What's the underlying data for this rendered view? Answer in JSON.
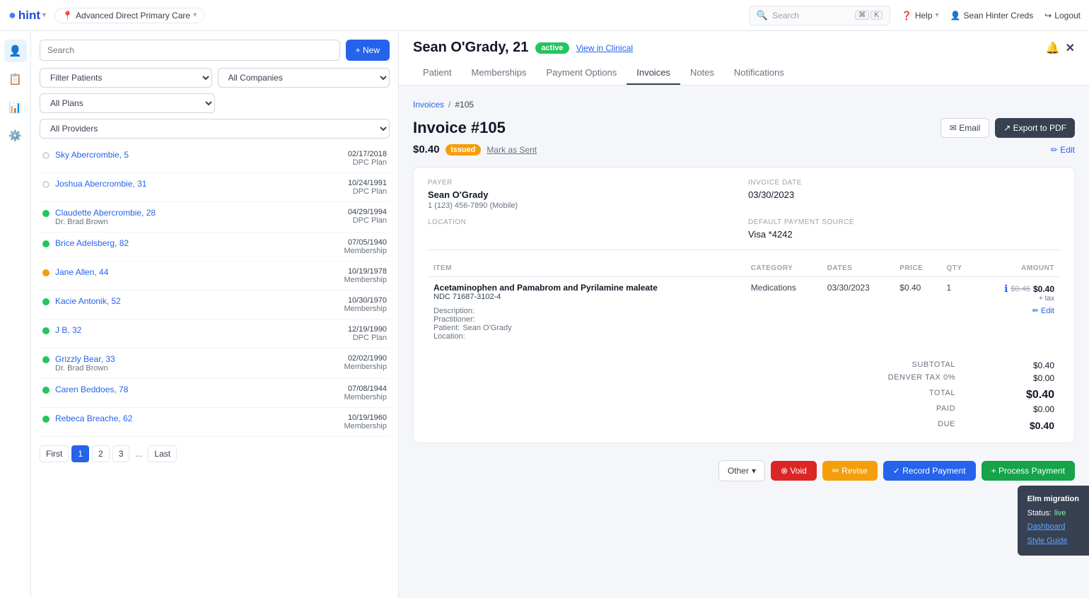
{
  "app": {
    "logo": "hint",
    "chevron": "▾",
    "location": "Advanced Direct Primary Care",
    "location_chevron": "▾"
  },
  "topbar": {
    "search_placeholder": "Search",
    "kbd1": "⌘",
    "kbd2": "K",
    "help": "Help",
    "user": "Sean Hinter Creds",
    "logout": "Logout"
  },
  "sidebar_icons": [
    "👤",
    "📋",
    "📊",
    "⚙️"
  ],
  "patient_panel": {
    "search_placeholder": "Search",
    "new_button": "+ New",
    "filter_patients": "Filter Patients",
    "all_companies": "All Companies",
    "all_plans": "All Plans",
    "all_providers": "All Providers",
    "patients": [
      {
        "name": "Sky Abercrombie, 5",
        "status": "inactive",
        "date": "02/17/2018",
        "plan": "DPC Plan"
      },
      {
        "name": "Joshua Abercrombie, 31",
        "status": "inactive",
        "date": "10/24/1991",
        "plan": "DPC Plan"
      },
      {
        "name": "Claudette Abercrombie, 28",
        "status": "active",
        "date": "04/29/1994",
        "plan": "DPC Plan",
        "sub": "Dr. Brad Brown"
      },
      {
        "name": "Brice Adelsberg, 82",
        "status": "active",
        "date": "07/05/1940",
        "plan": "Membership"
      },
      {
        "name": "Jane Allen, 44",
        "status": "pending",
        "date": "10/19/1978",
        "plan": "Membership"
      },
      {
        "name": "Kacie Antonik, 52",
        "status": "active",
        "date": "10/30/1970",
        "plan": "Membership"
      },
      {
        "name": "J B, 32",
        "status": "active",
        "date": "12/19/1990",
        "plan": "DPC Plan"
      },
      {
        "name": "Grizzly Bear, 33",
        "status": "active",
        "date": "02/02/1990",
        "plan": "Membership",
        "sub": "Dr. Brad Brown"
      },
      {
        "name": "Caren Beddoes, 78",
        "status": "active",
        "date": "07/08/1944",
        "plan": "Membership"
      },
      {
        "name": "Rebeca Breache, 62",
        "status": "active",
        "date": "10/19/1960",
        "plan": "Membership"
      }
    ],
    "pagination": {
      "first": "First",
      "page1": "1",
      "page2": "2",
      "page3": "3",
      "ellipsis": "...",
      "last": "Last"
    }
  },
  "patient_detail": {
    "name": "Sean O'Grady, 21",
    "status": "active",
    "view_clinical": "View in Clinical",
    "tabs": [
      "Patient",
      "Memberships",
      "Payment Options",
      "Invoices",
      "Notes",
      "Notifications"
    ],
    "active_tab": "Invoices"
  },
  "invoice": {
    "breadcrumb_parent": "Invoices",
    "breadcrumb_sep": "/",
    "breadcrumb_child": "#105",
    "title": "Invoice #105",
    "amount": "$0.40",
    "status": "Issued",
    "mark_as_sent": "Mark as Sent",
    "edit_label": "✏ Edit",
    "email_label": "✉ Email",
    "export_label": "↗ Export to PDF",
    "payer_label": "PAYER",
    "payer_name": "Sean O'Grady",
    "payer_phone": "1 (123) 456-7890 (Mobile)",
    "invoice_date_label": "INVOICE DATE",
    "invoice_date": "03/30/2023",
    "location_label": "LOCATION",
    "location_value": "",
    "payment_source_label": "DEFAULT PAYMENT SOURCE",
    "payment_source": "Visa *4242",
    "table_headers": {
      "item": "ITEM",
      "category": "CATEGORY",
      "dates": "DATES",
      "price": "PRICE",
      "qty": "QTY",
      "amount": "AMOUNT"
    },
    "line_item": {
      "name": "Acetaminophen and Pamabrom and Pyrilamine maleate",
      "ndc": "NDC 71687-3102-4",
      "category": "Medications",
      "date": "03/30/2023",
      "price": "$0.40",
      "qty": "1",
      "original_amount": "$0.46",
      "amount": "$0.40",
      "plus_tax": "+ tax",
      "edit": "✏ Edit"
    },
    "description_label": "Description:",
    "practitioner_label": "Practitioner:",
    "patient_label": "Patient:",
    "patient_value": "Sean O'Grady",
    "location_desc_label": "Location:",
    "subtotal_label": "SUBTOTAL",
    "subtotal_value": "$0.40",
    "tax_label": "DENVER TAX 0%",
    "tax_value": "$0.00",
    "total_label": "TOTAL",
    "total_value": "$0.40",
    "paid_label": "PAID",
    "paid_value": "$0.00",
    "due_label": "DUE",
    "due_value": "$0.40"
  },
  "actions": {
    "other": "Other",
    "chevron": "▾",
    "void": "⊗ Void",
    "revise": "✏ Revise",
    "record_payment": "✓ Record Payment",
    "process_payment": "+ Process Payment"
  },
  "migration": {
    "title": "Elm migration",
    "status_label": "Status:",
    "status_value": "live",
    "dashboard": "Dashboard",
    "style_guide": "Style Guide"
  }
}
